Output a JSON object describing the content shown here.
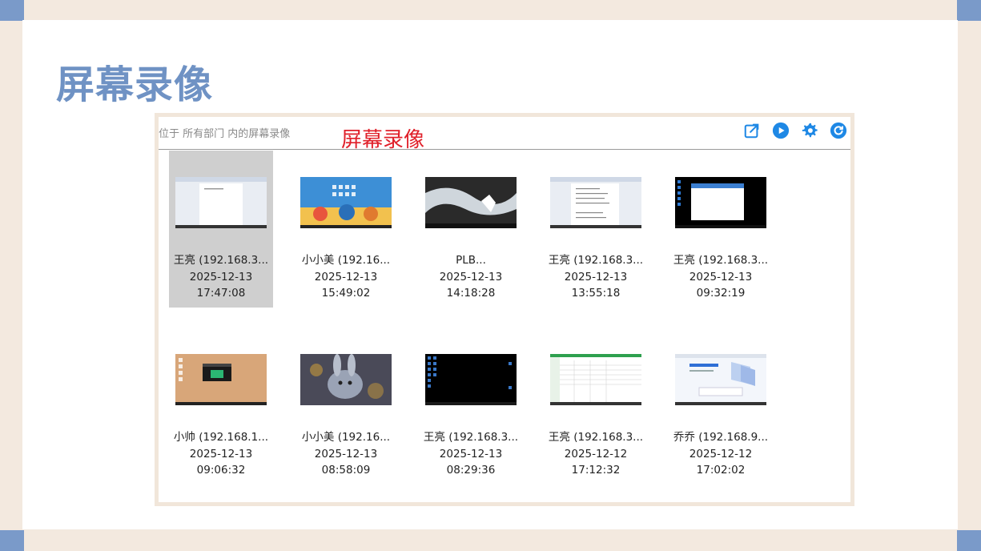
{
  "slide": {
    "title": "屏幕录像"
  },
  "toolbar": {
    "breadcrumb": "位于 所有部门 内的屏幕录像",
    "annotation": "屏幕录像",
    "icons": [
      "export-icon",
      "play-icon",
      "gear-icon",
      "refresh-icon"
    ]
  },
  "colors": {
    "accent_blue": "#1e88e5",
    "title_blue": "#6f92c4",
    "annotation_red": "#e0202a",
    "corner_blue": "#7a9ac9"
  },
  "recordings": [
    {
      "name": "王亮 (192.168.3...",
      "date": "2025-12-13",
      "time": "17:47:08",
      "selected": true,
      "thumb": "document"
    },
    {
      "name": "小小美 (192.16...",
      "date": "2025-12-13",
      "time": "15:49:02",
      "selected": false,
      "thumb": "colorful-desktop"
    },
    {
      "name": "PLB...",
      "date": "2025-12-13",
      "time": "14:18:28",
      "selected": false,
      "thumb": "ice-wallpaper"
    },
    {
      "name": "王亮 (192.168.3...",
      "date": "2025-12-13",
      "time": "13:55:18",
      "selected": false,
      "thumb": "document-list"
    },
    {
      "name": "王亮 (192.168.3...",
      "date": "2025-12-13",
      "time": "09:32:19",
      "selected": false,
      "thumb": "dark-desktop-window"
    },
    {
      "name": "小帅 (192.168.1...",
      "date": "2025-12-13",
      "time": "09:06:32",
      "selected": false,
      "thumb": "tan-desktop"
    },
    {
      "name": "小小美 (192.16...",
      "date": "2025-12-13",
      "time": "08:58:09",
      "selected": false,
      "thumb": "rabbit-wallpaper"
    },
    {
      "name": "王亮 (192.168.3...",
      "date": "2025-12-13",
      "time": "08:29:36",
      "selected": false,
      "thumb": "black-desktop"
    },
    {
      "name": "王亮 (192.168.3...",
      "date": "2025-12-12",
      "time": "17:12:32",
      "selected": false,
      "thumb": "spreadsheet"
    },
    {
      "name": "乔乔 (192.168.9...",
      "date": "2025-12-12",
      "time": "17:02:02",
      "selected": false,
      "thumb": "web-page"
    }
  ]
}
